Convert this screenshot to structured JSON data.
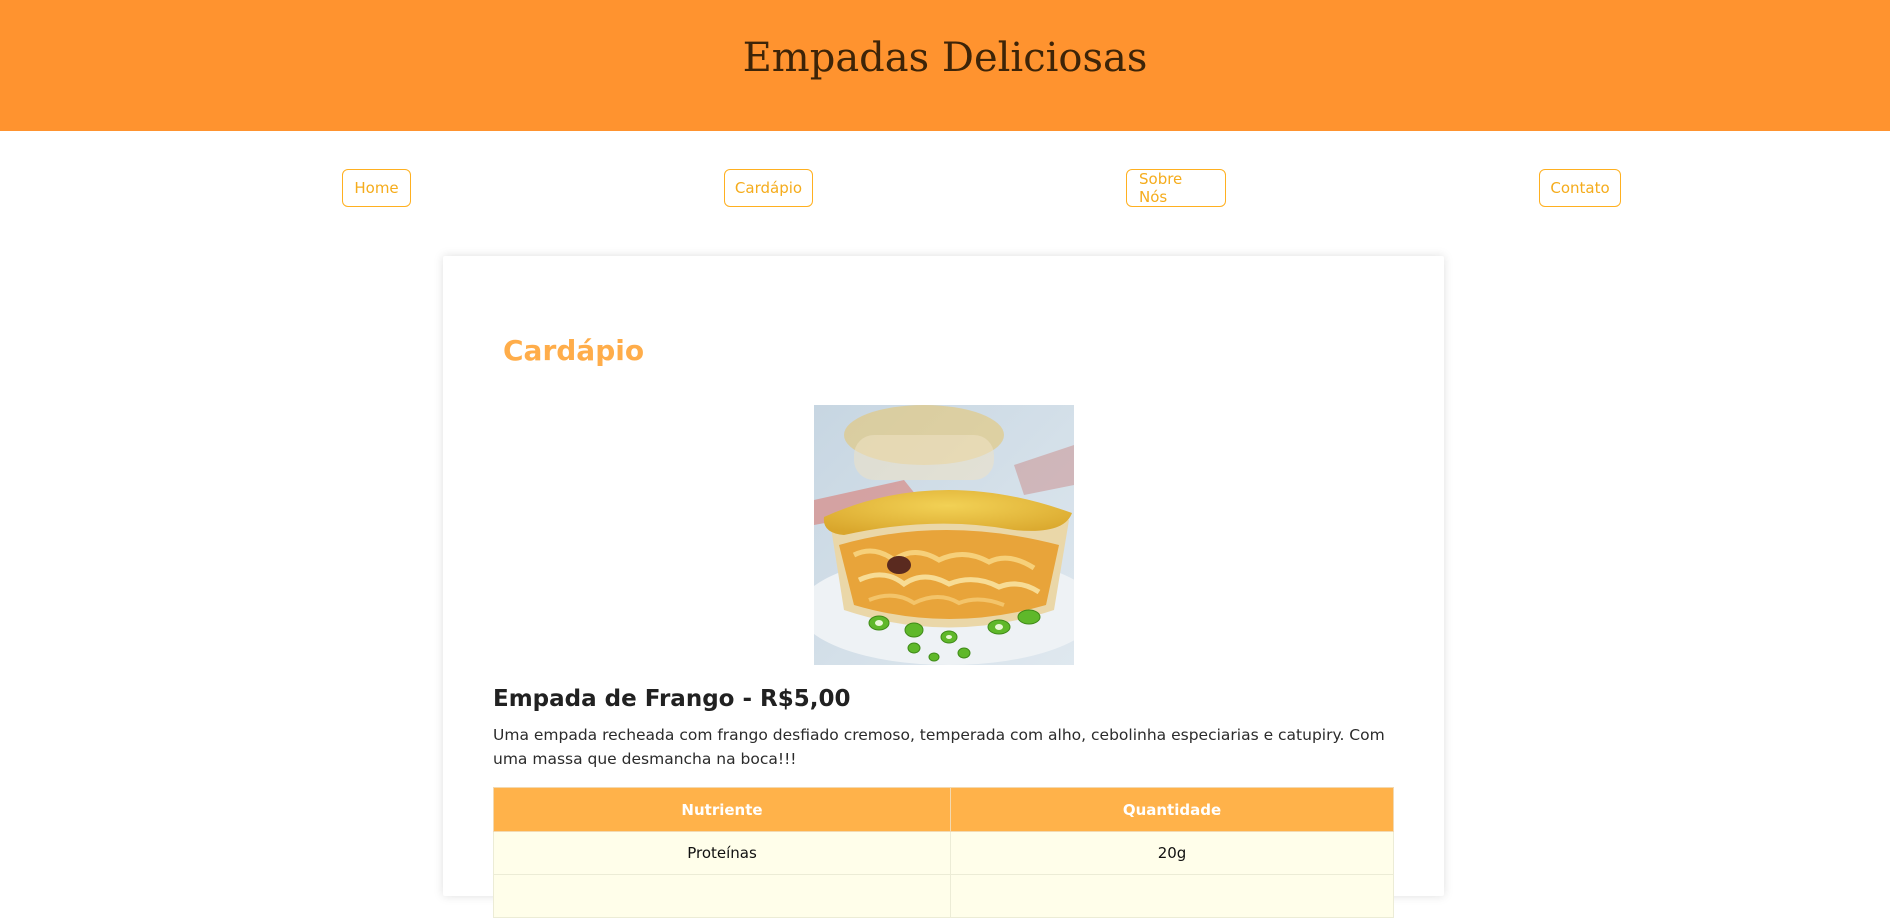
{
  "header": {
    "title": "Empadas Deliciosas"
  },
  "nav": [
    {
      "label": "Home"
    },
    {
      "label": "Cardápio"
    },
    {
      "label": "Sobre Nós"
    },
    {
      "label": "Contato"
    }
  ],
  "menu": {
    "title": "Cardápio",
    "product": {
      "name": "Empada de Frango - R$5,00",
      "description": "Uma empada recheada com frango desfiado cremoso, temperada com alho, cebolinha especiarias e catupiry. Com uma massa que desmancha na boca!!!",
      "image_icon": "chicken-empada-photo"
    },
    "table": {
      "headers": [
        "Nutriente",
        "Quantidade"
      ],
      "rows": [
        [
          "Proteínas",
          "20g"
        ],
        [
          "",
          ""
        ]
      ]
    }
  },
  "colors": {
    "header_bg": "#ff932f",
    "accent": "#ffb24a",
    "nav_border": "#ffb020",
    "table_row_bg": "#fffeea"
  }
}
